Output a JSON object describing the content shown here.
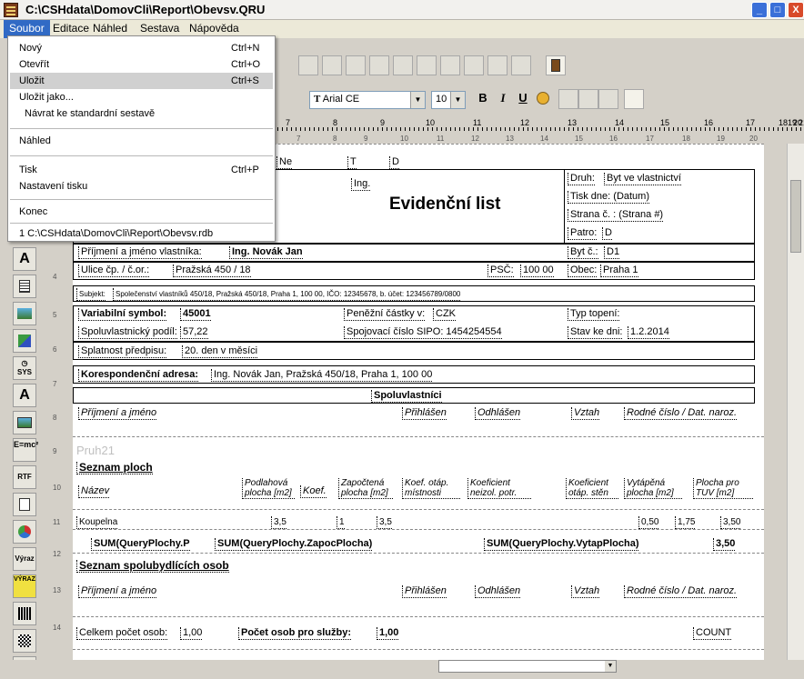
{
  "window": {
    "title": "C:\\CSHdata\\DomovCli\\Report\\Obevsv.QRU",
    "minimize": "_",
    "maximize": "□",
    "close": "X"
  },
  "menu": [
    "Soubor",
    "Editace",
    "Náhled",
    "Sestava",
    "Nápověda"
  ],
  "file_menu": {
    "items": [
      {
        "label": "Nový",
        "shortcut": "Ctrl+N"
      },
      {
        "label": "Otevřít",
        "shortcut": "Ctrl+O"
      },
      {
        "label": "Uložit",
        "shortcut": "Ctrl+S"
      },
      {
        "label": "Uložit jako...",
        "shortcut": ""
      },
      {
        "label": "Návrat ke standardní sestavě",
        "shortcut": ""
      },
      {
        "label": "Náhled",
        "shortcut": ""
      },
      {
        "label": "Tisk",
        "shortcut": "Ctrl+P"
      },
      {
        "label": "Nastavení tisku",
        "shortcut": ""
      },
      {
        "label": "Konec",
        "shortcut": ""
      },
      {
        "label": "1 C:\\CSHdata\\DomovCli\\Report\\Obevsv.rdb",
        "shortcut": ""
      }
    ]
  },
  "format_toolbar": {
    "font": "Arial CE",
    "size": "10",
    "bold": "B",
    "italic": "I",
    "underline": "U"
  },
  "ruler": {
    "top": [
      "7",
      "8",
      "9",
      "10",
      "11",
      "12",
      "13",
      "14",
      "15",
      "16",
      "17",
      "18",
      "19",
      "20",
      "21"
    ],
    "bottom": [
      "7",
      "8",
      "9",
      "10",
      "11",
      "12",
      "13",
      "14",
      "15",
      "16",
      "17",
      "18",
      "19",
      "20"
    ]
  },
  "left_tools": [
    "A",
    "",
    "",
    "",
    "",
    "SYS",
    "A",
    "",
    "E=mc²",
    "RTF",
    "",
    "",
    "Výraz",
    "VÝRAZ",
    "",
    ""
  ],
  "line_numbers": [
    "4",
    "5",
    "6",
    "7",
    "8",
    "9",
    "10",
    "11",
    "12",
    "13",
    "14"
  ],
  "report": {
    "ne": "Ne",
    "t1": "T",
    "d1": "D",
    "ing": "Ing.",
    "title": "Evidenční list",
    "druh": "Druh:",
    "druh_val": "Byt ve vlastnictví",
    "tisk_dne": "Tisk dne: (Datum)",
    "strana": "Strana č. : (Strana #)",
    "patro": "Patro:",
    "patro_val": "D",
    "prijmeni_vlastnika": "Příjmení a jméno vlastníka:",
    "prijmeni_vlastnika_val": "Ing. Novák Jan",
    "byt_c": "Byt č.:",
    "byt_c_val": "D1",
    "ulice": "Ulice čp. / č.or.:",
    "ulice_val": "Pražská 450 / 18",
    "psc": "PSČ:",
    "psc_val": "100 00",
    "obec": "Obec:",
    "obec_val": "Praha 1",
    "subjekt": "Subjekt:",
    "subjekt_val": "Společenství vlastníků 450/18, Pražská 450/18, Praha 1, 100 00, IČO: 12345678, b. účet: 123456789/0800",
    "vs": "Variabilní symbol:",
    "vs_val": "45001",
    "penezni": "Peněžní částky v:",
    "penezni_val": "CZK",
    "typ_topeni": "Typ topení:",
    "podil": "Spoluvlastnický podíl:",
    "podil_val": "57,22",
    "sipo": "Spojovací číslo SIPO: 1454254554",
    "stav": "Stav ke dni:",
    "stav_val": "1.2.2014",
    "splatnost": "Splatnost předpisu:",
    "splatnost_val": "20. den v měsíci",
    "koresp": "Korespondenční adresa:",
    "koresp_val": "Ing. Novák Jan, Pražská 450/18, Praha 1, 100 00",
    "spoluvl": "Spoluvlastníci",
    "h_prijmeni": "Příjmení a jméno",
    "h_prihlasen": "Přihlášen",
    "h_odhlasen": "Odhlášen",
    "h_vztah": "Vztah",
    "h_rc": "Rodné číslo / Dat. naroz.",
    "pruh21": "Pruh21",
    "seznam_ploch": "Seznam ploch",
    "p_nazev": "Název",
    "p_podlahova": "Podlahová plocha [m2]",
    "p_koef": "Koef.",
    "p_zapoctena": "Započtená plocha [m2]",
    "p_koef_otap": "Koef. otáp. místnosti",
    "p_koef_neizol": "Koeficient neizol. potr.",
    "p_koef_otap_sten": "Koeficient otáp. stěn",
    "p_vytapena": "Vytápěná plocha [m2]",
    "p_plocha_tuv": "Plocha pro TUV [m2]",
    "koupelna": "Koupelna",
    "k1": "3,5",
    "k2": "1",
    "k3": "3,5",
    "k4": "0,50",
    "k5": "1,75",
    "k6": "3,50",
    "sum1": "SUM(QueryPlochy.P",
    "sum2": "SUM(QueryPlochy.ZapocPlocha)",
    "sum3": "SUM(QueryPlochy.VytapPlocha)",
    "sum4": "3,50",
    "seznam_osob": "Seznam spolubydlících osob",
    "celkem": "Celkem počet osob:",
    "celkem_val": "1,00",
    "pocet_sluzby": "Počet osob pro služby:",
    "pocet_sluzby_val": "1,00",
    "count": "COUNT"
  }
}
